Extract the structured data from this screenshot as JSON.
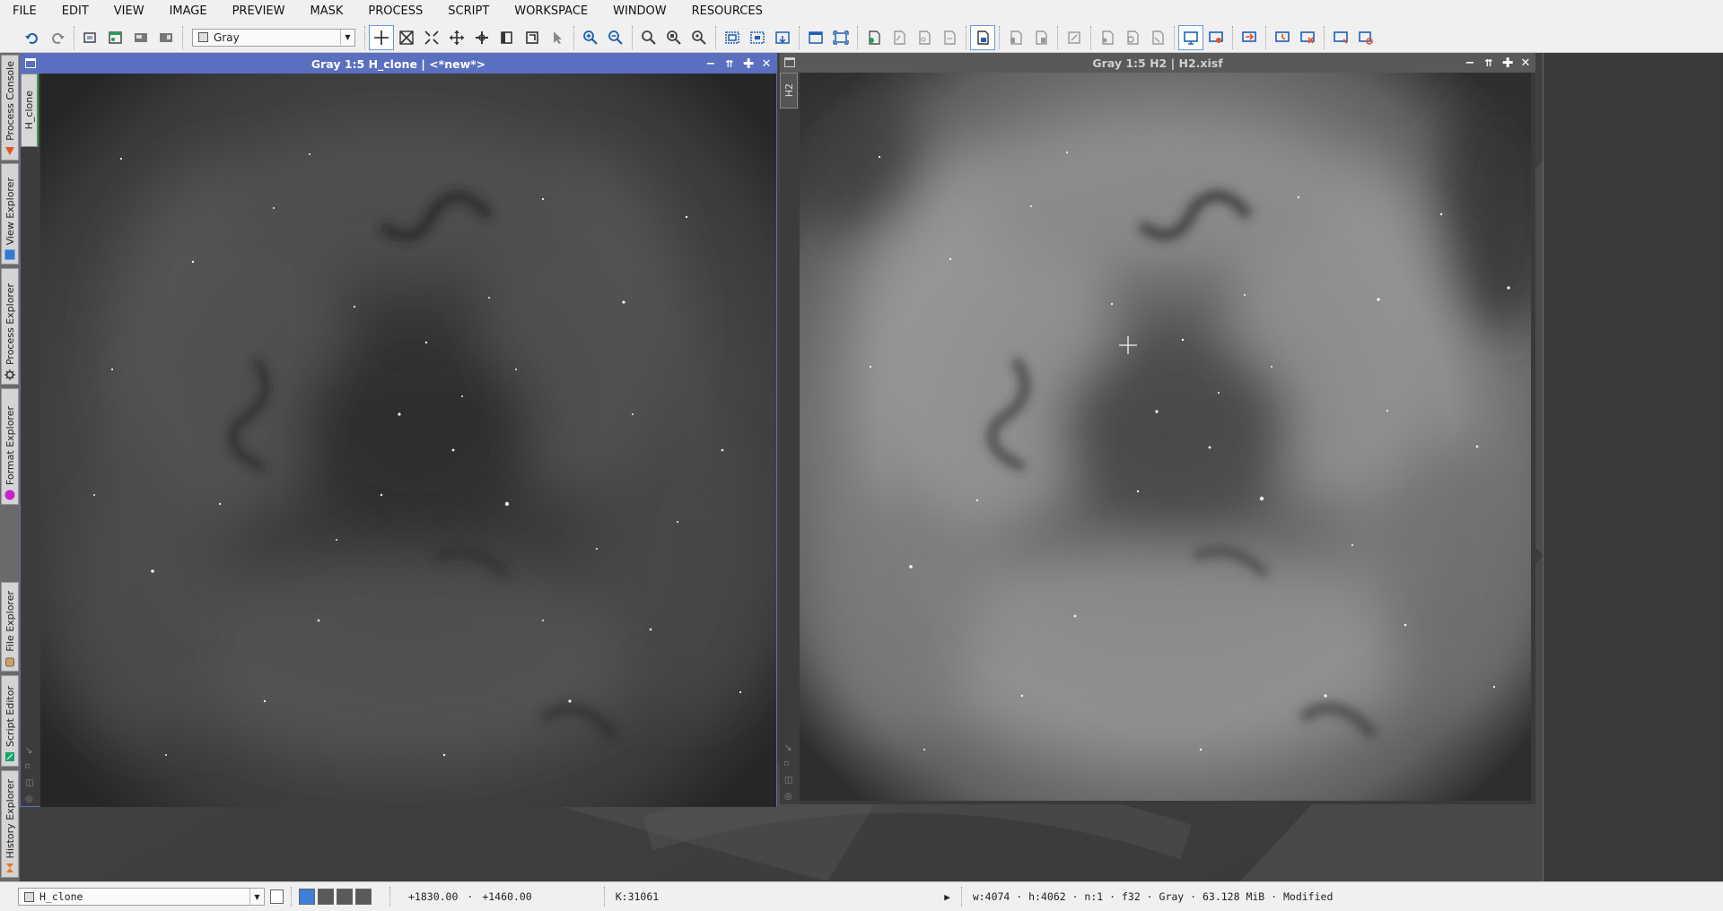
{
  "menu": [
    "FILE",
    "EDIT",
    "VIEW",
    "IMAGE",
    "PREVIEW",
    "MASK",
    "PROCESS",
    "SCRIPT",
    "WORKSPACE",
    "WINDOW",
    "RESOURCES"
  ],
  "toolbar": {
    "color_mode_value": "Gray"
  },
  "sidebar": {
    "tabs": [
      {
        "label": "Process Console",
        "icon": "warning-triangle-icon",
        "color": "#e0552b"
      },
      {
        "label": "View Explorer",
        "icon": "blue-square-icon",
        "color": "#2f7bd6"
      },
      {
        "label": "Process Explorer",
        "icon": "gear-icon",
        "color": "#333333"
      },
      {
        "label": "Format Explorer",
        "icon": "magenta-circle-icon",
        "color": "#c825c8"
      },
      {
        "label": "File Explorer",
        "icon": "cylinder-icon",
        "color": "#c6a56b"
      },
      {
        "label": "Script Editor",
        "icon": "green-flag-icon",
        "color": "#1aa36a"
      },
      {
        "label": "History Explorer",
        "icon": "hourglass-icon",
        "color": "#e07b1c"
      }
    ]
  },
  "windows": [
    {
      "title": "Gray 1:5 H_clone | <*new*>",
      "view_tab": "H_clone",
      "active": true
    },
    {
      "title": "Gray 1:5 H2 | H2.xisf",
      "view_tab": "H2",
      "active": false
    }
  ],
  "status": {
    "view_selector": "H_clone",
    "coord_x": "+1830.00",
    "coord_separator": "·",
    "coord_y": "+1460.00",
    "pixel_value": "K:31061",
    "image_info": "w:4074 · h:4062 · n:1 · f32 · Gray · 63.128 MiB · Modified"
  },
  "colors": {
    "active_title": "#5a6fbf",
    "inactive_title": "#595959",
    "menubar": "#f0f0f0"
  }
}
